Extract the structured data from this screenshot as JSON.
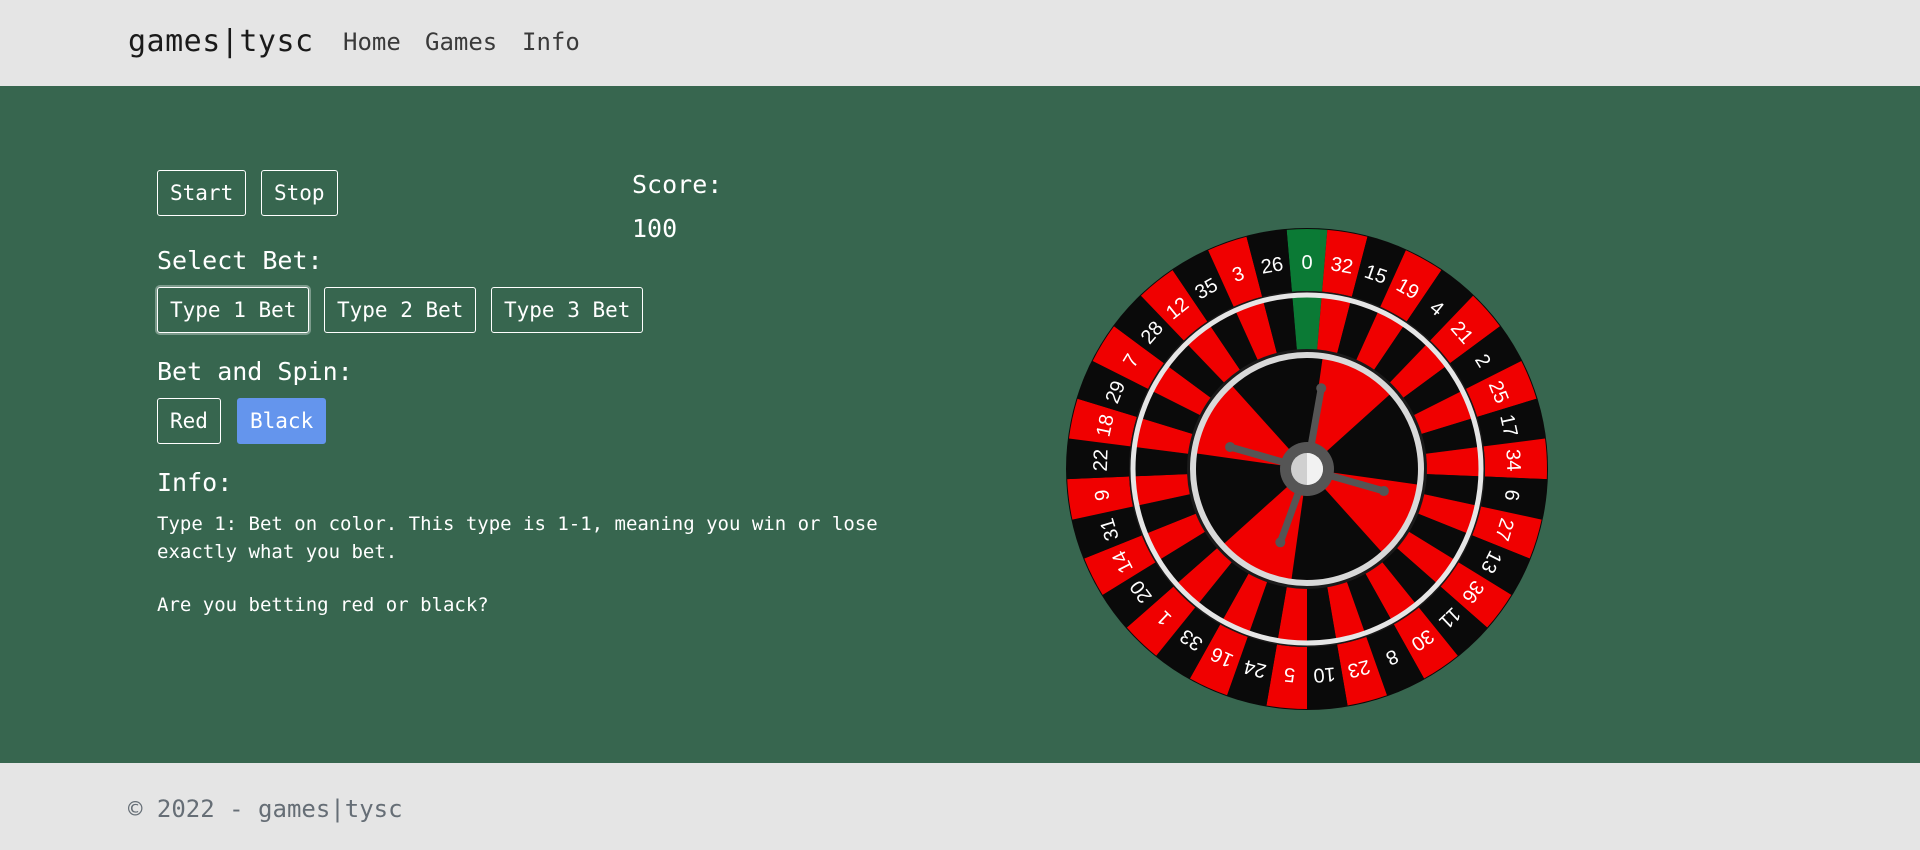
{
  "nav": {
    "brand": "games|tysc",
    "links": [
      {
        "label": "Home"
      },
      {
        "label": "Games"
      },
      {
        "label": "Info"
      }
    ]
  },
  "controls": {
    "start_label": "Start",
    "stop_label": "Stop",
    "select_bet_heading": "Select Bet:",
    "bet_types": [
      {
        "label": "Type 1 Bet",
        "selected": true
      },
      {
        "label": "Type 2 Bet",
        "selected": false
      },
      {
        "label": "Type 3 Bet",
        "selected": false
      }
    ],
    "bet_spin_heading": "Bet and Spin:",
    "red_label": "Red",
    "black_label": "Black",
    "active_color": "Black"
  },
  "score": {
    "label": "Score:",
    "value": "100"
  },
  "info": {
    "heading": "Info:",
    "description": "Type 1: Bet on color. This type is 1-1, meaning you win or lose exactly what you bet.",
    "question": "Are you betting red or black?"
  },
  "wheel": {
    "numbers": [
      "0",
      "32",
      "15",
      "19",
      "4",
      "21",
      "2",
      "25",
      "17",
      "34",
      "6",
      "27",
      "13",
      "36",
      "11",
      "30",
      "8",
      "23",
      "10",
      "5",
      "24",
      "16",
      "33",
      "1",
      "20",
      "14",
      "31",
      "9",
      "22",
      "18",
      "29",
      "7",
      "28",
      "12",
      "35",
      "3",
      "26"
    ],
    "colors": {
      "red": "#f00000",
      "black": "#0a0a0a",
      "green": "#0b7a35",
      "hub": "#555555"
    }
  },
  "footer": {
    "copyright": "© 2022 - games|tysc"
  }
}
